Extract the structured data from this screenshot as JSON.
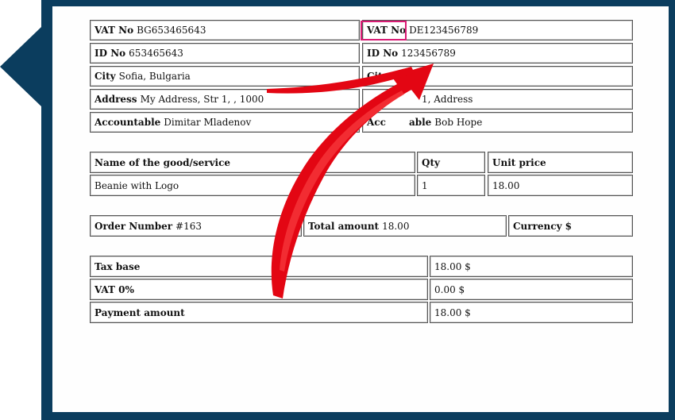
{
  "seller": {
    "vat_label": "VAT No",
    "vat_value": "BG653465643",
    "id_label": "ID No",
    "id_value": "653465643",
    "city_label": "City",
    "city_value": "Sofia, Bulgaria",
    "address_label": "Address",
    "address_value": "My Address, Str 1, , 1000",
    "accountable_label": "Accountable",
    "accountable_value": "Dimitar Mladenov"
  },
  "buyer": {
    "vat_label": "VAT No",
    "vat_value": "DE123456789",
    "id_label": "ID No",
    "id_value": "123456789",
    "city_label": "Cit",
    "address_value": "1, Address",
    "accountable_label": "Acc",
    "accountable_label_tail": "able",
    "accountable_value": "Bob Hope"
  },
  "items": {
    "headers": {
      "name": "Name of the good/service",
      "qty": "Qty",
      "unit_price": "Unit price"
    },
    "rows": [
      {
        "name": "Beanie with Logo",
        "qty": "1",
        "unit_price": "18.00"
      }
    ]
  },
  "order": {
    "number_label": "Order Number",
    "number_value": "#163",
    "total_label": "Total amount",
    "total_value": "18.00",
    "currency_label": "Currency",
    "currency_value": "$"
  },
  "totals": {
    "tax_base_label": "Tax base",
    "tax_base_value": "18.00 $",
    "vat_label": "VAT 0%",
    "vat_value": "0.00 $",
    "payment_label": "Payment amount",
    "payment_value": "18.00 $"
  },
  "colors": {
    "frame": "#0b3d5e",
    "arrow": "#e30613",
    "highlight": "#d81b74"
  }
}
